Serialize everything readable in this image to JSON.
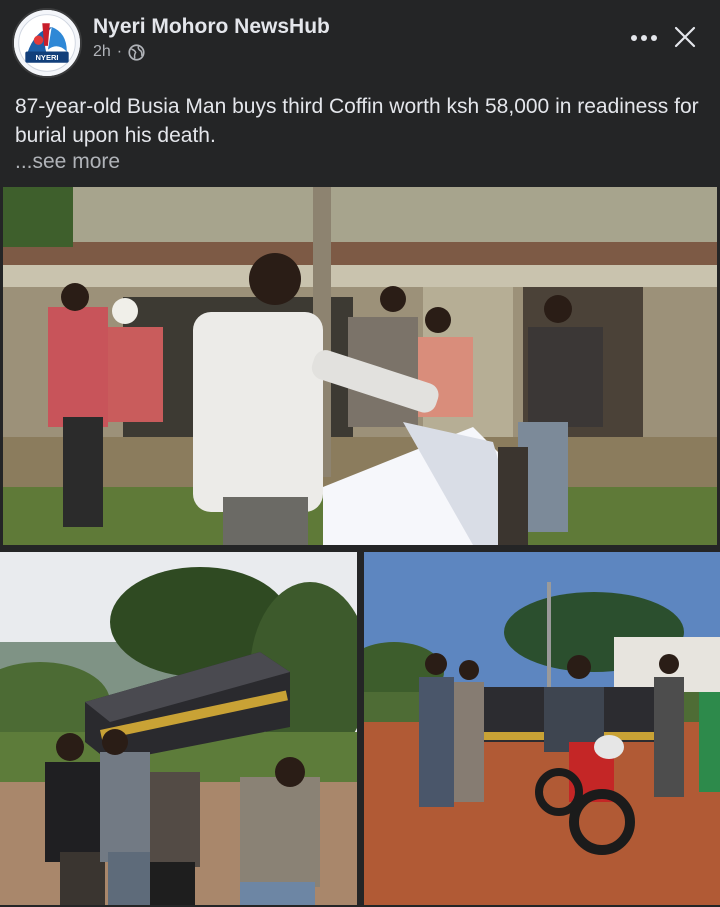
{
  "post": {
    "author": "Nyeri Mohoro NewsHub",
    "time": "2h",
    "separator": "·",
    "audience_icon": "globe-icon",
    "caption": "87-year-old Busia Man buys third Coffin worth ksh 58,000 in readiness for burial upon his death.",
    "see_more": "...see more",
    "avatar_text": "NYERI"
  },
  "photos": [
    {
      "description_icon": "photo-man-with-coffin"
    },
    {
      "description_icon": "photo-coffin-carried"
    },
    {
      "description_icon": "photo-coffin-on-motorbike"
    }
  ],
  "colors": {
    "background": "#242526",
    "text_primary": "#e4e6eb",
    "text_secondary": "#b0b3b8"
  }
}
